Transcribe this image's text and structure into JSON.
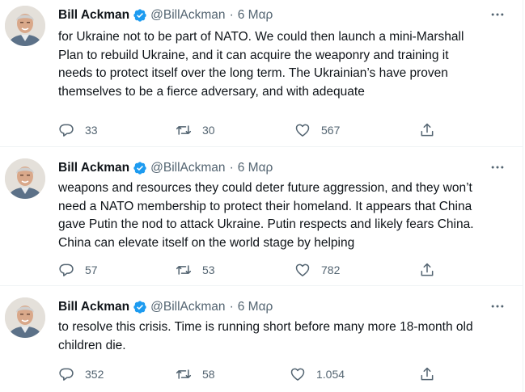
{
  "tweets": [
    {
      "name": "Bill Ackman",
      "handle": "@BillAckman",
      "separator": "·",
      "date": "6 Μαρ",
      "text": "for Ukraine not to be part of NATO.  We could then launch a mini-Marshall\nPlan to rebuild Ukraine, and it can acquire the weaponry and training it\nneeds to protect itself over the long term.  The Ukrainian’s have proven\nthemselves to be a fierce adversary, and with adequate",
      "replies": "33",
      "retweets": "30",
      "likes": "567"
    },
    {
      "name": "Bill Ackman",
      "handle": "@BillAckman",
      "separator": "·",
      "date": "6 Μαρ",
      "text": "weapons and resources they could deter future aggression, and they won’t\nneed a NATO membership to protect their homeland.  It appears that China\ngave Putin the nod to attack Ukraine.  Putin respects and likely fears China.\nChina can elevate itself on the world stage by helping",
      "replies": "57",
      "retweets": "53",
      "likes": "782"
    },
    {
      "name": "Bill Ackman",
      "handle": "@BillAckman",
      "separator": "·",
      "date": "6 Μαρ",
      "text": "to resolve this crisis. Time is running short before many more 18-month old\nchildren die.",
      "replies": "352",
      "retweets": "58",
      "likes": "1.054"
    }
  ],
  "icons": {
    "verified": "verified-badge-icon",
    "more": "more-icon",
    "reply": "reply-icon",
    "retweet": "retweet-icon",
    "like": "like-icon",
    "share": "share-icon"
  },
  "colors": {
    "text": "#0f1419",
    "secondary": "#536471",
    "verified": "#1d9bf0",
    "divider": "#eff3f4"
  }
}
